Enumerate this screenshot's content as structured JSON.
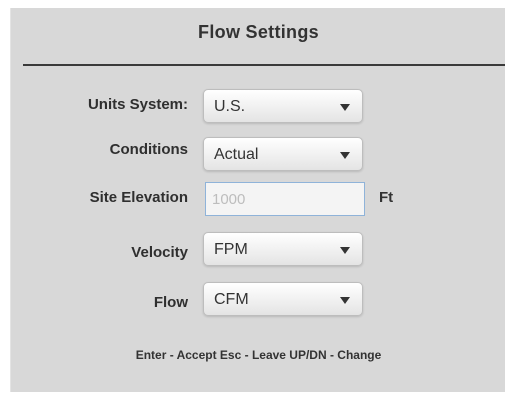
{
  "panel": {
    "title": "Flow Settings"
  },
  "fields": {
    "units_system": {
      "label": "Units System:",
      "value": "U.S."
    },
    "conditions": {
      "label": "Conditions",
      "value": "Actual"
    },
    "site_elevation": {
      "label": "Site Elevation",
      "placeholder": "1000",
      "unit": "Ft"
    },
    "velocity": {
      "label": "Velocity",
      "value": "FPM"
    },
    "flow": {
      "label": "Flow",
      "value": "CFM"
    }
  },
  "footer": {
    "hint": "Enter - Accept Esc - Leave UP/DN - Change"
  },
  "colors": {
    "panel_background": "#d8d8d8",
    "input_focus_border": "#8fb3d9"
  }
}
